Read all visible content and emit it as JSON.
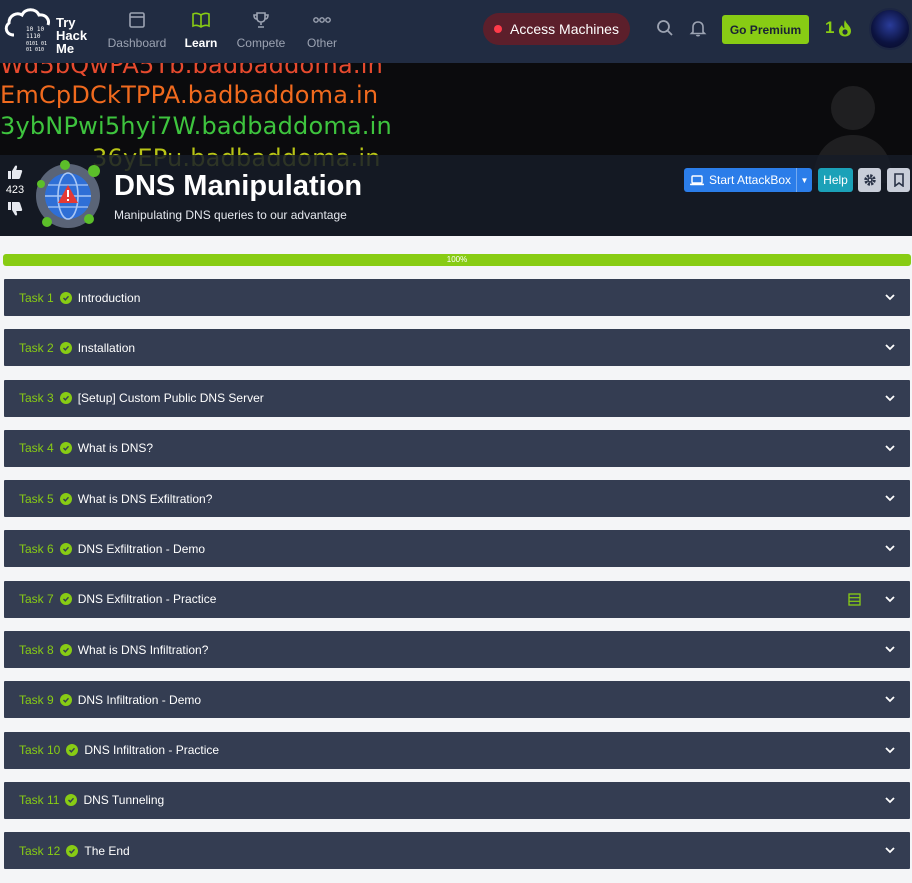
{
  "brand": {
    "name_lines": [
      "Try",
      "Hack",
      "Me"
    ]
  },
  "nav": {
    "items": [
      {
        "label": "Dashboard",
        "icon": "dashboard-icon"
      },
      {
        "label": "Learn",
        "icon": "book-icon",
        "active": true
      },
      {
        "label": "Compete",
        "icon": "trophy-icon"
      },
      {
        "label": "Other",
        "icon": "more-icon"
      }
    ],
    "access_machines": "Access Machines",
    "go_premium": "Go Premium",
    "streak": "1"
  },
  "banner": {
    "lines": [
      {
        "text": "Wd5bQwPA5Tb.badbaddoma.in",
        "color": "#e64a2e"
      },
      {
        "text": "EmCpDCkTPPA.badbaddoma.in",
        "color": "#f06a1e"
      },
      {
        "text": "3ybNPwi5hyi7W.badbaddoma.in",
        "color": "#3ec43e"
      },
      {
        "text": "36yEPu.badbaddoma.in",
        "color": "#b8c416"
      }
    ]
  },
  "room": {
    "title": "DNS Manipulation",
    "subtitle": "Manipulating DNS queries to our advantage",
    "votes": "423",
    "start_attackbox": "Start AttackBox",
    "help": "Help"
  },
  "progress": {
    "label": "100%",
    "value": 100
  },
  "tasks": [
    {
      "num": "Task 1",
      "title": "Introduction"
    },
    {
      "num": "Task 2",
      "title": "Installation"
    },
    {
      "num": "Task 3",
      "title": "[Setup] Custom Public DNS Server"
    },
    {
      "num": "Task 4",
      "title": "What is DNS?"
    },
    {
      "num": "Task 5",
      "title": "What is DNS Exfiltration?"
    },
    {
      "num": "Task 6",
      "title": "DNS Exfiltration - Demo"
    },
    {
      "num": "Task 7",
      "title": "DNS Exfiltration - Practice",
      "extra_icon": "server-icon"
    },
    {
      "num": "Task 8",
      "title": "What is DNS Infiltration?"
    },
    {
      "num": "Task 9",
      "title": "DNS Infiltration - Demo"
    },
    {
      "num": "Task 10",
      "title": "DNS Infiltration - Practice"
    },
    {
      "num": "Task 11",
      "title": "DNS Tunneling"
    },
    {
      "num": "Task 12",
      "title": "The End"
    }
  ]
}
